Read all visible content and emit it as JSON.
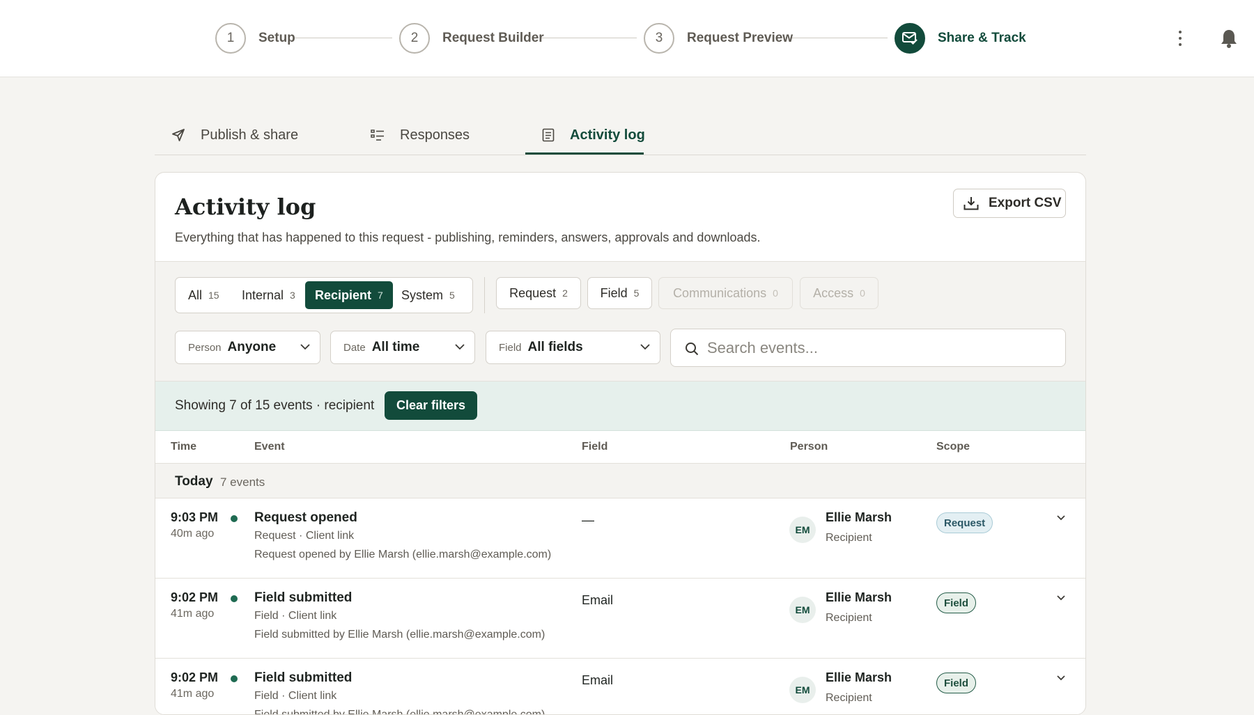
{
  "stepper": {
    "steps": [
      {
        "number": "1",
        "label": "Setup"
      },
      {
        "number": "2",
        "label": "Request Builder"
      },
      {
        "number": "3",
        "label": "Request Preview"
      },
      {
        "number": "",
        "label": "Share & Track"
      }
    ],
    "active_step": "Share & Track"
  },
  "tabs": {
    "publish": "Publish & share",
    "responses": "Responses",
    "activity": "Activity log",
    "active": "Activity log"
  },
  "card": {
    "title": "Activity log",
    "subtitle": "Everything that has happened to this request - publishing, reminders, answers, approvals and downloads.",
    "export_label": "Export CSV"
  },
  "filters": {
    "audience": [
      {
        "label": "All",
        "count": "15"
      },
      {
        "label": "Internal",
        "count": "3"
      },
      {
        "label": "Recipient",
        "count": "7"
      },
      {
        "label": "System",
        "count": "5"
      }
    ],
    "active_audience": "Recipient",
    "scopes": [
      {
        "label": "Request",
        "count": "2",
        "enabled": true
      },
      {
        "label": "Field",
        "count": "5",
        "enabled": true
      },
      {
        "label": "Communications",
        "count": "0",
        "enabled": false
      },
      {
        "label": "Access",
        "count": "0",
        "enabled": false
      }
    ],
    "person": {
      "label": "Person",
      "value": "Anyone"
    },
    "date": {
      "label": "Date",
      "value": "All time"
    },
    "field": {
      "label": "Field",
      "value": "All fields"
    },
    "search_placeholder": "Search events..."
  },
  "banner": {
    "text": "Showing 7 of 15 events · recipient",
    "clear_label": "Clear filters"
  },
  "table": {
    "headers": {
      "time": "Time",
      "event": "Event",
      "field": "Field",
      "person": "Person",
      "scope": "Scope"
    },
    "group": {
      "title": "Today",
      "count": "7 events"
    },
    "rows": [
      {
        "time": "9:03 PM",
        "ago": "40m ago",
        "title": "Request opened",
        "meta": "Request · Client link",
        "desc": "Request opened by Ellie Marsh (ellie.marsh@example.com)",
        "field": "—",
        "initials": "EM",
        "person": "Ellie Marsh",
        "role": "Recipient",
        "scope": "Request"
      },
      {
        "time": "9:02 PM",
        "ago": "41m ago",
        "title": "Field submitted",
        "meta": "Field · Client link",
        "desc": "Field submitted by Ellie Marsh (ellie.marsh@example.com)",
        "field": "Email",
        "initials": "EM",
        "person": "Ellie Marsh",
        "role": "Recipient",
        "scope": "Field"
      },
      {
        "time": "9:02 PM",
        "ago": "41m ago",
        "title": "Field submitted",
        "meta": "Field · Client link",
        "desc": "Field submitted by Ellie Marsh (ellie.marsh@example.com)",
        "field": "Email",
        "initials": "EM",
        "person": "Ellie Marsh",
        "role": "Recipient",
        "scope": "Field"
      }
    ]
  },
  "colors": {
    "brand": "#124b3b",
    "banner_bg": "#e6f0ec",
    "page_bg": "#f5f4f1"
  },
  "icons": {
    "publish": "paper-plane-icon",
    "responses": "list-icon",
    "activity": "document-icon",
    "export": "download-icon",
    "search": "search-icon",
    "menu": "kebab-menu-icon",
    "notifications": "bell-icon",
    "share_step": "mail-check-icon"
  }
}
